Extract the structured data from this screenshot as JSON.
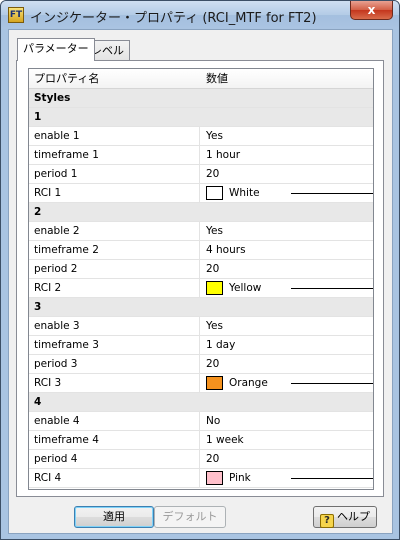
{
  "window": {
    "icon_text": "FT",
    "title": "インジケーター・プロパティ (RCI_MTF for FT2)",
    "close_glyph": "x"
  },
  "tabs": [
    {
      "label": "パラメーター",
      "active": true
    },
    {
      "label": "レベル",
      "active": false
    }
  ],
  "grid": {
    "columns": [
      "プロパティ名",
      "数値"
    ],
    "rows": [
      {
        "type": "section",
        "name": "Styles"
      },
      {
        "type": "section",
        "name": "1"
      },
      {
        "type": "prop",
        "name": "enable 1",
        "value": "Yes"
      },
      {
        "type": "prop",
        "name": "timeframe 1",
        "value": "1 hour"
      },
      {
        "type": "prop",
        "name": "period 1",
        "value": "20"
      },
      {
        "type": "color",
        "name": "RCI 1",
        "value": "White",
        "color": "#ffffff"
      },
      {
        "type": "section",
        "name": "2"
      },
      {
        "type": "prop",
        "name": "enable 2",
        "value": "Yes"
      },
      {
        "type": "prop",
        "name": "timeframe 2",
        "value": "4 hours"
      },
      {
        "type": "prop",
        "name": "period 2",
        "value": "20"
      },
      {
        "type": "color",
        "name": "RCI 2",
        "value": "Yellow",
        "color": "#ffff00"
      },
      {
        "type": "section",
        "name": "3"
      },
      {
        "type": "prop",
        "name": "enable 3",
        "value": "Yes"
      },
      {
        "type": "prop",
        "name": "timeframe 3",
        "value": "1 day"
      },
      {
        "type": "prop",
        "name": "period 3",
        "value": "20"
      },
      {
        "type": "color",
        "name": "RCI 3",
        "value": "Orange",
        "color": "#f5921e"
      },
      {
        "type": "section",
        "name": "4"
      },
      {
        "type": "prop",
        "name": "enable 4",
        "value": "No"
      },
      {
        "type": "prop",
        "name": "timeframe 4",
        "value": "1 week"
      },
      {
        "type": "prop",
        "name": "period 4",
        "value": "20"
      },
      {
        "type": "color",
        "name": "RCI 4",
        "value": "Pink",
        "color": "#ffc0cb"
      }
    ]
  },
  "footer": {
    "apply_label": "適用",
    "default_label": "デフォルト",
    "help_label": "ヘルプ",
    "help_icon_glyph": "?"
  }
}
